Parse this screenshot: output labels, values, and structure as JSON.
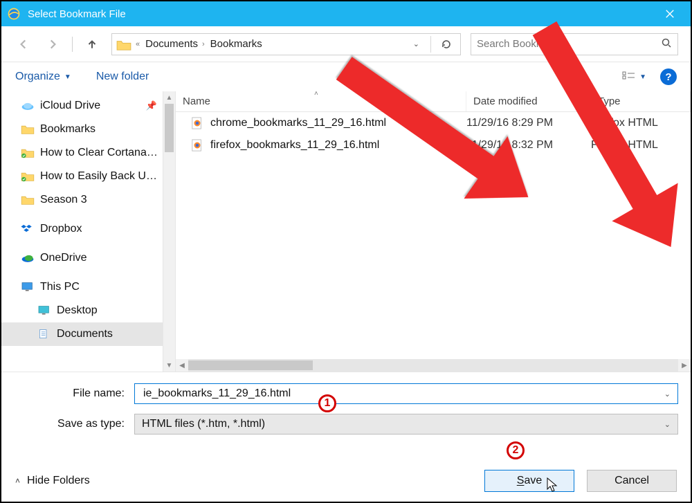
{
  "title": "Select Bookmark File",
  "breadcrumb": {
    "items": [
      "Documents",
      "Bookmarks"
    ]
  },
  "search": {
    "placeholder": "Search Bookmarks"
  },
  "toolbar": {
    "organize": "Organize",
    "new_folder": "New folder"
  },
  "tree": {
    "items": [
      {
        "label": "iCloud Drive",
        "icon": "cloud",
        "pinned": true
      },
      {
        "label": "Bookmarks",
        "icon": "folder"
      },
      {
        "label": "How to Clear Cortana…",
        "icon": "folder-check"
      },
      {
        "label": "How to Easily Back U…",
        "icon": "folder-check"
      },
      {
        "label": "Season 3",
        "icon": "folder"
      },
      {
        "label": "Dropbox",
        "icon": "dropbox"
      },
      {
        "label": "OneDrive",
        "icon": "onedrive"
      },
      {
        "label": "This PC",
        "icon": "pc"
      },
      {
        "label": "Desktop",
        "icon": "desktop",
        "sub": true
      },
      {
        "label": "Documents",
        "icon": "documents",
        "sub": true,
        "selected": true
      }
    ]
  },
  "columns": {
    "name": "Name",
    "date": "Date modified",
    "type": "Type"
  },
  "files": [
    {
      "name": "chrome_bookmarks_11_29_16.html",
      "date": "11/29/16 8:29 PM",
      "type": "Firefox HTML"
    },
    {
      "name": "firefox_bookmarks_11_29_16.html",
      "date": "11/29/16 8:32 PM",
      "type": "Firefox HTML"
    }
  ],
  "form": {
    "filename_label": "File name:",
    "filename_value": "ie_bookmarks_11_29_16.html",
    "savetype_label": "Save as type:",
    "savetype_value": "HTML files (*.htm, *.html)"
  },
  "footer": {
    "hide_folders": "Hide Folders",
    "save": "Save",
    "cancel": "Cancel"
  },
  "annotations": {
    "badge1": "1",
    "badge2": "2"
  }
}
